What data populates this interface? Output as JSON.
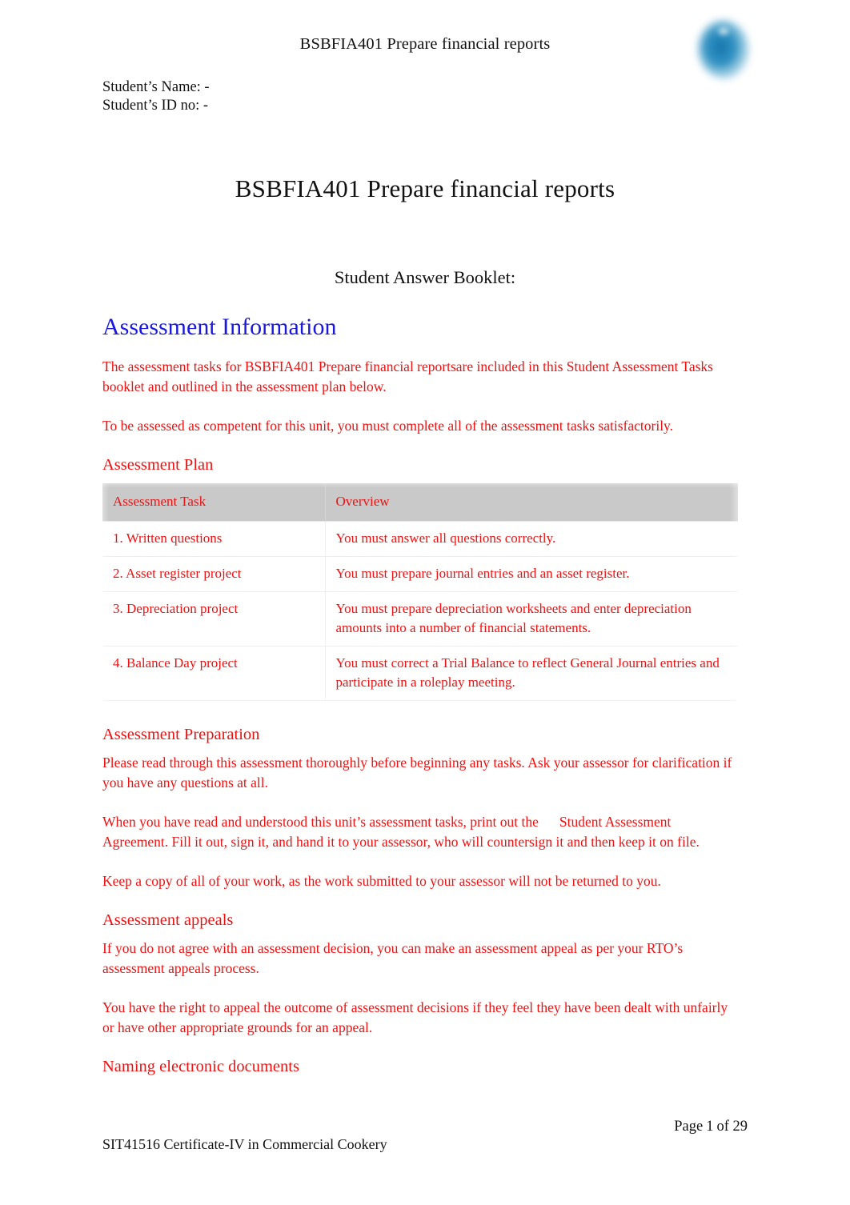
{
  "document": {
    "header_title": "BSBFIA401 Prepare financial reports",
    "logo_icon": "blue-globe-logo-icon",
    "main_title": "BSBFIA401 Prepare financial reports",
    "sub_title": "Student Answer Booklet:"
  },
  "student": {
    "name_label": "Student’s Name: -",
    "id_label": "Student’s ID no: -"
  },
  "colors": {
    "heading_blue": "#1a18e0",
    "body_red": "#f01010",
    "table_header_grey": "#c9c9c9",
    "text_black": "#111111"
  },
  "assessment_information": {
    "heading": "Assessment Information",
    "intro_paragraph": "The assessment tasks for  BSBFIA401 Prepare financial reportsare included in this Student Assessment Tasks booklet and outlined in the assessment plan below.",
    "competency_paragraph": "To be assessed as competent for this unit, you must complete all of the assessment tasks satisfactorily."
  },
  "assessment_plan": {
    "heading": "Assessment Plan",
    "columns": [
      "Assessment Task",
      "Overview"
    ],
    "rows": [
      {
        "task": "1. Written questions",
        "overview": "You must answer all questions correctly."
      },
      {
        "task": "2. Asset register project",
        "overview": "You must prepare journal entries and an asset register."
      },
      {
        "task": "3. Depreciation project",
        "overview": "You must prepare depreciation worksheets and enter depreciation amounts into a number of financial statements."
      },
      {
        "task": "4. Balance Day project",
        "overview": "You must correct a Trial Balance to reflect General Journal entries and participate in a roleplay meeting."
      }
    ]
  },
  "assessment_preparation": {
    "heading": "Assessment Preparation",
    "paragraph_1": "Please read through this assessment thoroughly before beginning any tasks. Ask your assessor for clarification if you have any questions at all.",
    "paragraph_2_part_1": "When you have read and understood this unit’s assessment tasks, print out the",
    "paragraph_2_part_2": "Student Assessment Agreement.  Fill it out, sign it, and hand it to your assessor, who will countersign it and then keep it on file.",
    "paragraph_3": "Keep a copy of all of your work, as the work submitted to your assessor will not be returned to you."
  },
  "assessment_appeals": {
    "heading": "Assessment appeals",
    "paragraph_1": "If you do not agree with an assessment decision, you can make an assessment appeal as per your RTO’s assessment appeals process.",
    "paragraph_2": "You have the right to appeal the outcome of assessment decisions if they feel they have been dealt with unfairly or have other appropriate grounds for an appeal."
  },
  "naming_documents": {
    "heading": "Naming electronic documents"
  },
  "footer": {
    "page_word": "Page",
    "page_number": "1",
    "of_word": "of",
    "page_total": "29",
    "course": "SIT41516 Certificate-IV in Commercial Cookery"
  }
}
